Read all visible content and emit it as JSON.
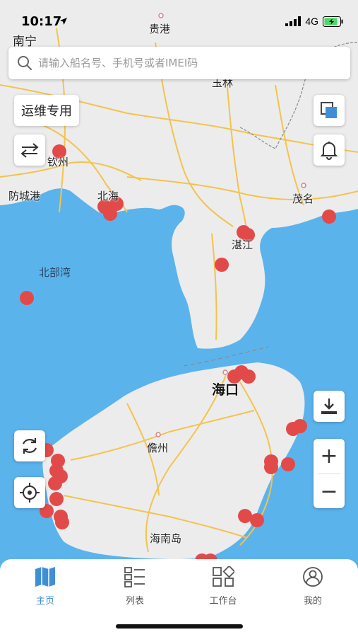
{
  "status": {
    "time": "10:17",
    "network": "4G"
  },
  "map": {
    "top_city": "南宁",
    "labels": {
      "guigang": "贵港",
      "yulin": "玉林",
      "qinzhou": "钦州",
      "fangchenggang": "防城港",
      "beihai": "北海",
      "maoming": "茂名",
      "zhanjiang": "湛江",
      "beibuwan": "北部湾",
      "haikou": "海口",
      "danzhou": "儋州",
      "hainandao": "海南岛"
    }
  },
  "search": {
    "placeholder": "请输入船名号、手机号或者IMEI码"
  },
  "tag_button": "运维专用",
  "colors": {
    "sea": "#5bb3ec",
    "land": "#ececec",
    "road": "#f3c34e",
    "marker": "#e24a4a",
    "accent": "#3f8fd6"
  },
  "icons": {
    "search": "search-icon",
    "swap": "swap-arrows-icon",
    "layers": "layers-icon",
    "bell": "bell-icon",
    "download": "download-icon",
    "refresh": "refresh-icon",
    "locate": "crosshair-icon"
  },
  "zoom": {
    "in": "+",
    "out": "−"
  },
  "tabs": [
    {
      "label": "主页",
      "icon": "map-icon",
      "active": true
    },
    {
      "label": "列表",
      "icon": "list-icon",
      "active": false
    },
    {
      "label": "工作台",
      "icon": "workbench-icon",
      "active": false
    },
    {
      "label": "我的",
      "icon": "profile-icon",
      "active": false
    }
  ]
}
